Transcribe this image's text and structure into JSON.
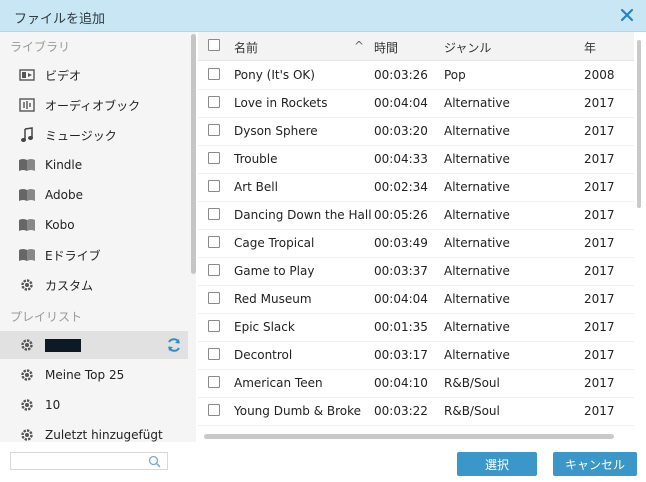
{
  "window": {
    "title": "ファイルを追加",
    "close_icon": "close-icon"
  },
  "sidebar": {
    "library_label": "ライブラリ",
    "library_items": [
      {
        "label": "ビデオ",
        "icon": "video-icon"
      },
      {
        "label": "オーディオブック",
        "icon": "audiobook-icon"
      },
      {
        "label": "ミュージック",
        "icon": "music-note-icon"
      },
      {
        "label": "Kindle",
        "icon": "book-icon"
      },
      {
        "label": "Adobe",
        "icon": "book-icon"
      },
      {
        "label": "Kobo",
        "icon": "book-icon"
      },
      {
        "label": "Eドライブ",
        "icon": "book-icon"
      },
      {
        "label": "カスタム",
        "icon": "gear-icon"
      }
    ],
    "playlist_label": "プレイリスト",
    "playlist_items": [
      {
        "label": "",
        "icon": "gear-icon",
        "selected": true
      },
      {
        "label": "Meine Top 25",
        "icon": "gear-icon"
      },
      {
        "label": "10",
        "icon": "gear-icon"
      },
      {
        "label": "Zuletzt hinzugefügt",
        "icon": "gear-icon"
      }
    ]
  },
  "search": {
    "placeholder": "",
    "icon": "search-icon"
  },
  "table": {
    "headers": {
      "name": "名前",
      "time": "時間",
      "genre": "ジャンル",
      "year": "年"
    },
    "rows": [
      {
        "name": "Pony (It's OK)",
        "time": "00:03:26",
        "genre": "Pop",
        "year": "2008"
      },
      {
        "name": "Love in Rockets",
        "time": "00:04:04",
        "genre": "Alternative",
        "year": "2017"
      },
      {
        "name": "Dyson Sphere",
        "time": "00:03:20",
        "genre": "Alternative",
        "year": "2017"
      },
      {
        "name": "Trouble",
        "time": "00:04:33",
        "genre": "Alternative",
        "year": "2017"
      },
      {
        "name": "Art Bell",
        "time": "00:02:34",
        "genre": "Alternative",
        "year": "2017"
      },
      {
        "name": "Dancing Down the Hall",
        "time": "00:05:26",
        "genre": "Alternative",
        "year": "2017"
      },
      {
        "name": "Cage Tropical",
        "time": "00:03:49",
        "genre": "Alternative",
        "year": "2017"
      },
      {
        "name": "Game to Play",
        "time": "00:03:37",
        "genre": "Alternative",
        "year": "2017"
      },
      {
        "name": "Red Museum",
        "time": "00:04:04",
        "genre": "Alternative",
        "year": "2017"
      },
      {
        "name": "Epic Slack",
        "time": "00:01:35",
        "genre": "Alternative",
        "year": "2017"
      },
      {
        "name": "Decontrol",
        "time": "00:03:17",
        "genre": "Alternative",
        "year": "2017"
      },
      {
        "name": "American Teen",
        "time": "00:04:10",
        "genre": "R&B/Soul",
        "year": "2017"
      },
      {
        "name": "Young Dumb & Broke",
        "time": "00:03:22",
        "genre": "R&B/Soul",
        "year": "2017"
      }
    ]
  },
  "buttons": {
    "select": "選択",
    "cancel": "キャンセル"
  },
  "colors": {
    "titlebar": "#c9e6f4",
    "accent": "#3b97c8",
    "close": "#1f86c2"
  }
}
